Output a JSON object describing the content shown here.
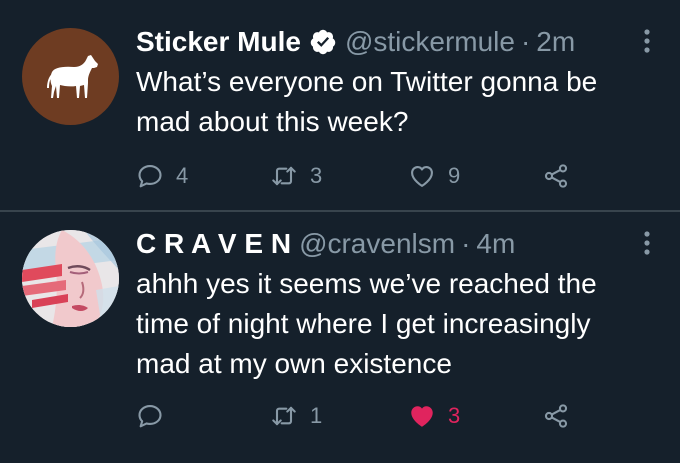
{
  "tweets": [
    {
      "author_name": "Sticker Mule",
      "verified": true,
      "handle": "@stickermule",
      "separator": "·",
      "time": "2m",
      "text_lines": [
        "What’s everyone on Twitter gonna be",
        "mad about this week?"
      ],
      "replies": "4",
      "retweets": "3",
      "likes": "9",
      "liked": false,
      "avatar_icon": "horse-icon"
    },
    {
      "author_name": "C R A V E N",
      "verified": false,
      "handle": "@cravenlsm",
      "separator": "·",
      "time": "4m",
      "text_lines": [
        "ahhh yes it seems we’ve reached the",
        "time of night where I get increasingly",
        "mad at my own existence"
      ],
      "replies": "",
      "retweets": "1",
      "likes": "3",
      "liked": true,
      "avatar_icon": "painted-face-avatar"
    }
  ],
  "colors": {
    "background": "#15202b",
    "secondary_text": "#8899a6",
    "divider": "#38444d",
    "like_active": "#e0245e",
    "verified_badge": "#ffffff"
  }
}
